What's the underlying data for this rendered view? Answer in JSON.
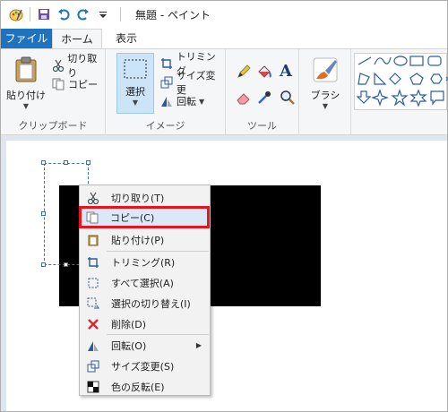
{
  "window": {
    "title": "無題 - ペイント"
  },
  "tabs": [
    {
      "label": "ファイル"
    },
    {
      "label": "ホーム"
    },
    {
      "label": "表示"
    }
  ],
  "ribbon": {
    "clipboard": {
      "paste_label": "貼り付け",
      "cut_label": "切り取り",
      "copy_label": "コピー",
      "group_label": "クリップボード"
    },
    "image": {
      "select_label": "選択",
      "crop_label": "トリミング",
      "resize_label": "サイズ変更",
      "rotate_label": "回転",
      "group_label": "イメージ"
    },
    "tools": {
      "group_label": "ツール",
      "text_tool": "A"
    },
    "brushes": {
      "label": "ブラシ"
    }
  },
  "context_menu": {
    "items": [
      {
        "label": "切り取り(T)"
      },
      {
        "label": "コピー(C)"
      },
      {
        "label": "貼り付け(P)"
      },
      {
        "label": "トリミング(R)"
      },
      {
        "label": "すべて選択(A)"
      },
      {
        "label": "選択の切り替え(I)"
      },
      {
        "label": "削除(D)"
      },
      {
        "label": "回転(O)"
      },
      {
        "label": "サイズ変更(S)"
      },
      {
        "label": "色の反転(E)"
      }
    ],
    "highlighted_index": 1
  },
  "colors": {
    "accent": "#1e73be",
    "highlight_border": "#e8131b",
    "selection_fill": "#cce4f7"
  }
}
